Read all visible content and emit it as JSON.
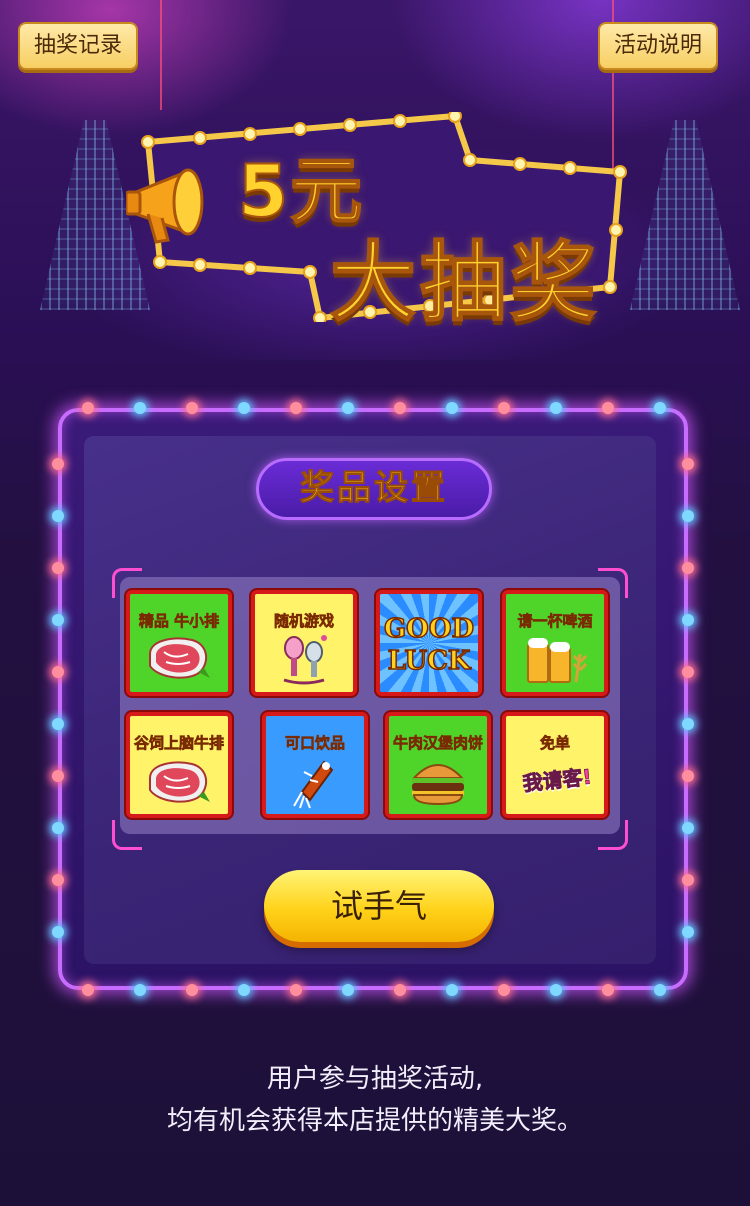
{
  "header": {
    "left_button": "抽奖记录",
    "right_button": "活动说明"
  },
  "banner": {
    "line1": "5元",
    "line2": "大抽奖"
  },
  "section_title": "奖品设置",
  "prizes": [
    {
      "label": "精品 牛小排",
      "bg": "#4fd52a",
      "icon": "steak-icon"
    },
    {
      "label": "随机游戏",
      "bg": "#fff36a",
      "icon": "microphone-icon"
    },
    {
      "label": "GOOD LUCK",
      "bg": "#3a9bff",
      "icon": "good-luck-icon"
    },
    {
      "label": "请一杯啤酒",
      "bg": "#4fd52a",
      "icon": "beer-icon"
    },
    {
      "label": "谷饲上脑牛排",
      "bg": "#fff36a",
      "icon": "steak-icon"
    },
    {
      "label": "可口饮品",
      "bg": "#3a9bff",
      "icon": "drink-icon"
    },
    {
      "label": "牛肉汉堡肉饼",
      "bg": "#4fd52a",
      "icon": "burger-icon"
    },
    {
      "label": "免单",
      "bg": "#fff36a",
      "icon": "treat-icon"
    }
  ],
  "good_luck": {
    "line1": "GOOD",
    "line2": "LUCK"
  },
  "treat_text": "我请客!",
  "action_button": "试手气",
  "description": {
    "line1": "用户参与抽奖活动,",
    "line2": "均有机会获得本店提供的精美大奖。"
  }
}
